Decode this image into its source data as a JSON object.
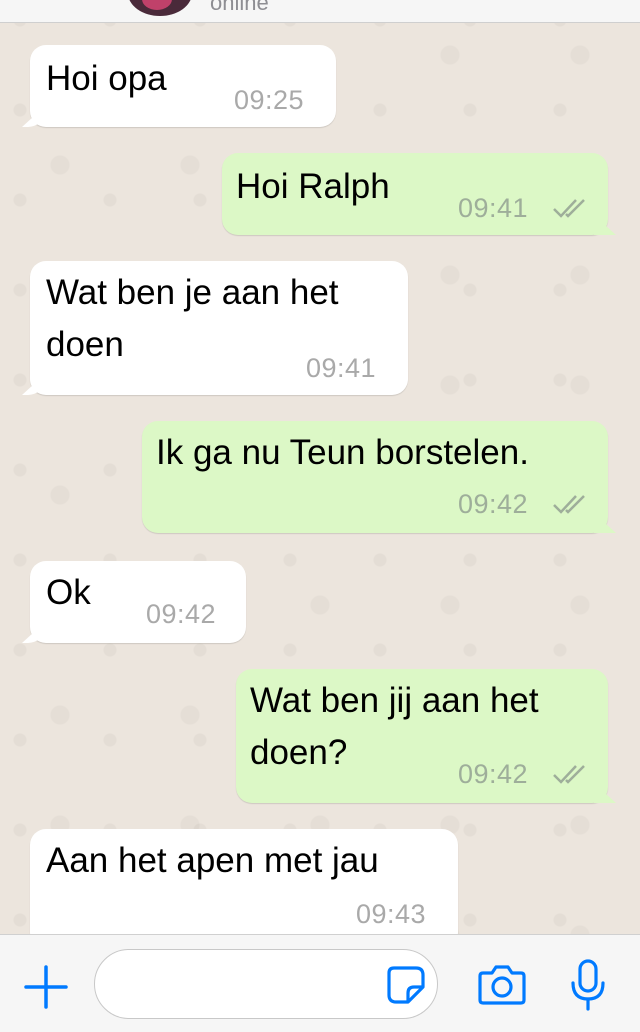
{
  "header": {
    "status": "online"
  },
  "messages": [
    {
      "id": "m1",
      "direction": "in",
      "text": "Hoi opa",
      "time": "09:25"
    },
    {
      "id": "m2",
      "direction": "out",
      "text": "Hoi Ralph",
      "time": "09:41",
      "read": true
    },
    {
      "id": "m3",
      "direction": "in",
      "text": "Wat ben je aan het\ndoen",
      "time": "09:41"
    },
    {
      "id": "m4",
      "direction": "out",
      "text": "Ik ga nu Teun borstelen.",
      "time": "09:42",
      "read": true
    },
    {
      "id": "m5",
      "direction": "in",
      "text": "Ok",
      "time": "09:42"
    },
    {
      "id": "m6",
      "direction": "out",
      "text": "Wat ben jij aan het\ndoen?",
      "time": "09:42",
      "read": true
    },
    {
      "id": "m7",
      "direction": "in",
      "text": "Aan het apen met jau",
      "time": "09:43"
    }
  ],
  "input_bar": {
    "message_value": "",
    "icons": [
      "plus-icon",
      "sticker-icon",
      "camera-icon",
      "microphone-icon"
    ]
  },
  "colors": {
    "incoming_bubble": "#ffffff",
    "outgoing_bubble": "#dcf8c6",
    "accent": "#007aff",
    "read_ticks": "#9eae9a"
  }
}
